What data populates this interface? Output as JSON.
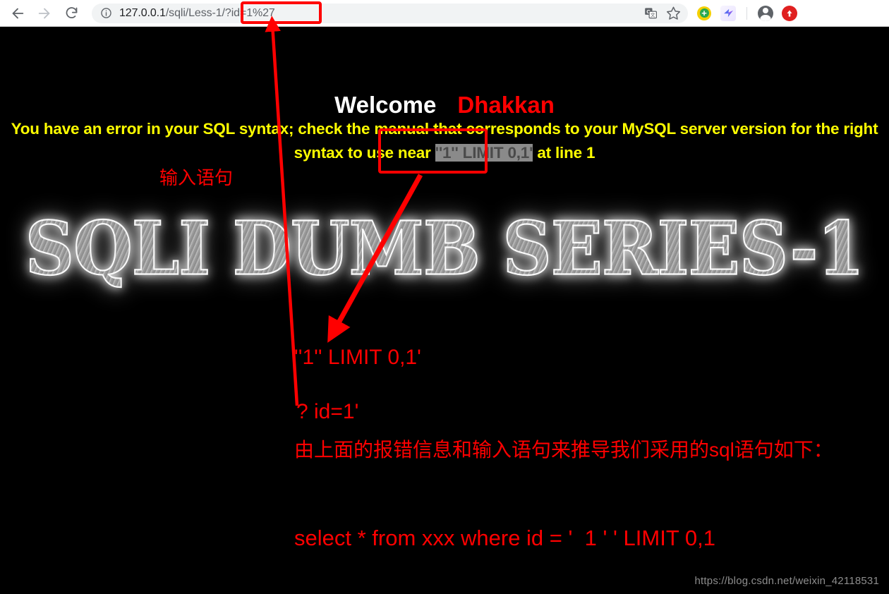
{
  "browser": {
    "back_label": "back-arrow",
    "forward_label": "forward-arrow",
    "reload_label": "reload",
    "site_info_label": "site-information",
    "url": {
      "full": "127.0.0.1/sqli/Less-1/?id=1%27",
      "host": "127.0.0.1",
      "path": "/sqli/Less-1/",
      "query": "?id=1%27"
    },
    "omni_actions": [
      "translate-icon",
      "bookmark-star-icon"
    ],
    "extensions": [
      "green-plus-extension-icon",
      "blue-bird-extension-icon"
    ],
    "profile_label": "profile-avatar",
    "app_menu_label": "red-arrow-extension-icon"
  },
  "page": {
    "welcome": "Welcome",
    "welcome_user": "Dhakkan",
    "error_part1": "You have an error in your SQL syntax; check the manual that corresponds to your MySQL server version for the right syntax to use near ",
    "error_selected": "''1'' LIMIT 0,1'",
    "error_part2": " at line 1",
    "banner": "SQLI DUMB SERIES-1",
    "watermark": "https://blog.csdn.net/weixin_42118531"
  },
  "annotations": {
    "input_statement_label": "输入语句",
    "limit_fragment": "''1'' LIMIT 0,1'",
    "id_fragment": "? id=1'",
    "deduction_text": "由上面的报错信息和输入语句来推导我们采用的sql语句如下：",
    "sql_statement": "select * from xxx where id = '  1 ' ' LIMIT 0,1"
  },
  "colors": {
    "annotation_red": "#ff0000",
    "error_yellow": "#ffff00",
    "page_background": "#000000",
    "selection_background": "#8a8a8a"
  }
}
